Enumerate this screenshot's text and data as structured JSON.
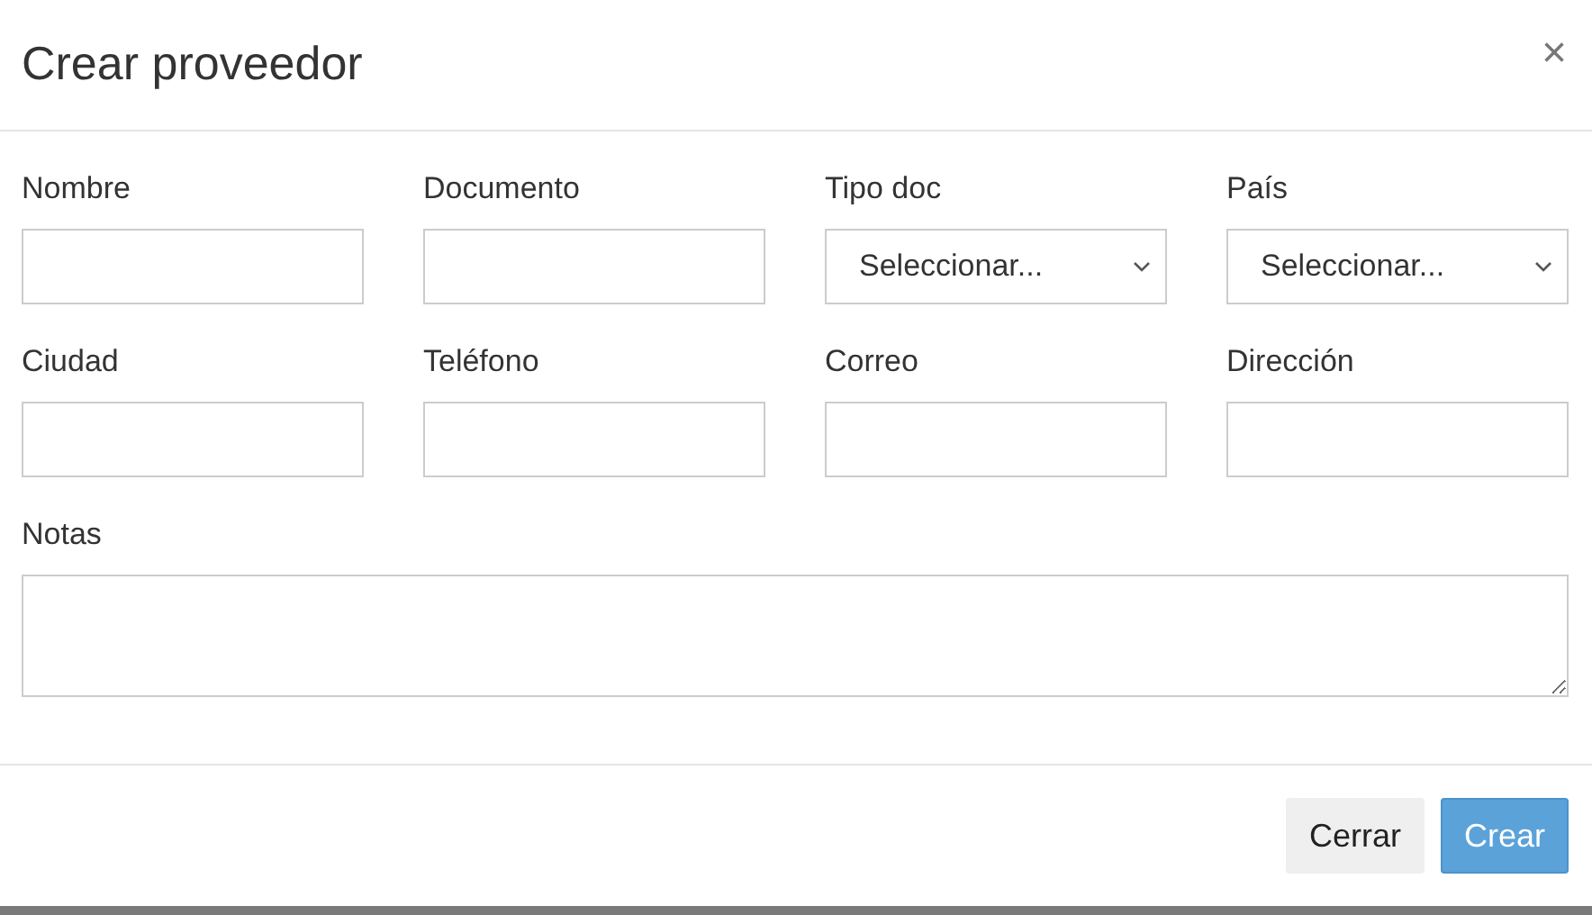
{
  "dialog": {
    "title": "Crear proveedor",
    "close": "×"
  },
  "fields": [
    {
      "label": "Nombre",
      "kind": "text"
    },
    {
      "label": "Documento",
      "kind": "text"
    },
    {
      "label": "Tipo doc",
      "kind": "select",
      "value": "Seleccionar..."
    },
    {
      "label": "País",
      "kind": "select",
      "value": "Seleccionar..."
    },
    {
      "label": "Ciudad",
      "kind": "text"
    },
    {
      "label": "Teléfono",
      "kind": "text"
    },
    {
      "label": "Correo",
      "kind": "text"
    },
    {
      "label": "Dirección",
      "kind": "text"
    },
    {
      "label": "Notas",
      "kind": "textarea"
    }
  ],
  "buttons": [
    {
      "label": "Cerrar",
      "kind": "secondary"
    },
    {
      "label": "Crear",
      "kind": "primary"
    }
  ]
}
